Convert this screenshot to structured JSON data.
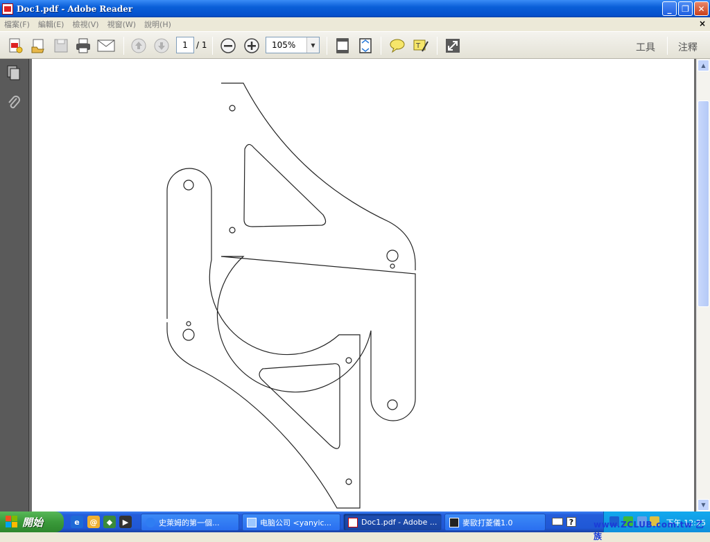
{
  "window": {
    "title": "Doc1.pdf - Adobe Reader"
  },
  "menu": {
    "items": [
      "檔案(F)",
      "編輯(E)",
      "檢視(V)",
      "視窗(W)",
      "說明(H)"
    ],
    "close_glyph": "×"
  },
  "toolbar": {
    "page_current": "1",
    "page_total": "/ 1",
    "zoom": "105%",
    "tools_label": "工具",
    "comment_label": "注釋"
  },
  "taskbar": {
    "start_label": "開始",
    "tasks": [
      {
        "label": "史萊姆的第一個...",
        "icon": "ie-icon"
      },
      {
        "label": "电脑公司 <yanyic...",
        "icon": "network-icon"
      },
      {
        "label": "Doc1.pdf - Adobe ...",
        "icon": "pdf-icon"
      },
      {
        "label": "麥歐打菱儀1.0",
        "icon": "app-icon"
      }
    ],
    "help_glyph": "?",
    "clock": "下午 12:25"
  },
  "watermark": "www.ZCLUB.com.tw 乙族",
  "colors": {
    "accent": "#0a5fd8",
    "taskbar": "#245edb",
    "start": "#3a9a3a"
  }
}
